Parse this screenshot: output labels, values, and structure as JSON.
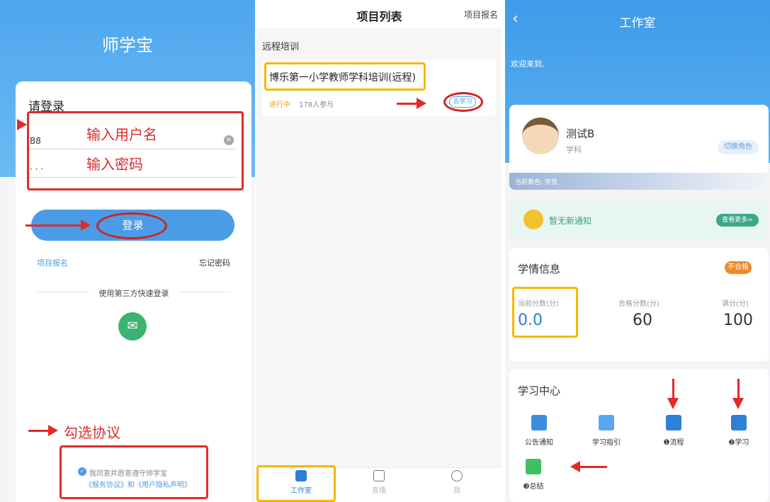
{
  "login": {
    "app_title": "师学宝",
    "prompt": "请登录",
    "username_value": "B8",
    "password_value": "· · ·",
    "annot_username": "输入用户名",
    "annot_password": "输入密码",
    "login_button": "登录",
    "link_signup": "项目报名",
    "link_forgot": "忘记密码",
    "third_party": "使用第三方快速登录",
    "annot_agree": "勾选协议",
    "agree_line1": "我同意并愿意遵守师学宝",
    "agree_line2": "《服务协议》和《用户隐私声明》"
  },
  "projects": {
    "title": "项目列表",
    "signup": "项目报名",
    "section": "远程培训",
    "card": {
      "name": "博乐第一小学教师学科培训(远程)",
      "status": "进行中",
      "participants": "178人参与",
      "go_button": "去学习"
    },
    "tabs": [
      {
        "label": "工作室",
        "icon": "book-icon"
      },
      {
        "label": "直播",
        "icon": "play-icon"
      },
      {
        "label": "我",
        "icon": "user-icon"
      }
    ]
  },
  "workroom": {
    "title": "工作室",
    "welcome": "欢迎来到,",
    "profile": {
      "name": "测试B",
      "subject": "学科",
      "switch_role": "切换角色",
      "current_role": "当前角色: 学员"
    },
    "notice": {
      "text": "暂无新通知",
      "more": "查看更多>"
    },
    "study_info": {
      "title": "学情信息",
      "badge": "不合格",
      "current_label": "当前分数(分)",
      "current_value": "0.0",
      "pass_label": "合格分数(分)",
      "pass_value": "60",
      "full_label": "满分(分)",
      "full_value": "100"
    },
    "learning_center": {
      "title": "学习中心",
      "items": [
        {
          "label": "公告通知",
          "icon": "notice-icon",
          "color": "#3a8ee0"
        },
        {
          "label": "学习指引",
          "icon": "guide-icon",
          "color": "#5aa6ee"
        },
        {
          "label": "❶流程",
          "icon": "book-icon",
          "color": "#2d7fd8"
        },
        {
          "label": "❷学习",
          "icon": "book-icon",
          "color": "#2d7fd8"
        },
        {
          "label": "❸总结",
          "icon": "summary-icon",
          "color": "#3ec060"
        }
      ]
    }
  }
}
